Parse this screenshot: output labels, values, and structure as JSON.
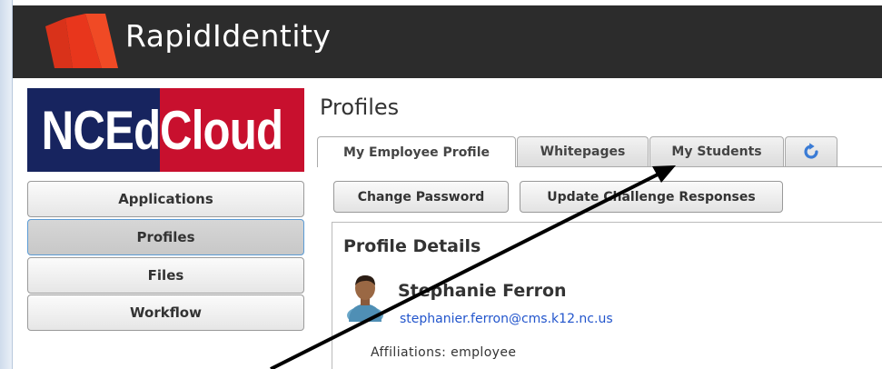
{
  "app": {
    "brand_name": "RapidIdentity",
    "brand_logo_icon": "rapididentity-logo-icon",
    "header_bg_color": "#2c2c2c",
    "logo_color": "#e8361c"
  },
  "banner": {
    "left_text": "NCEd",
    "right_text": "Cloud",
    "left_color": "#17245f",
    "right_color": "#c8102e"
  },
  "sidebar": {
    "items": [
      {
        "label": "Applications",
        "active": false
      },
      {
        "label": "Profiles",
        "active": true
      },
      {
        "label": "Files",
        "active": false
      },
      {
        "label": "Workflow",
        "active": false
      }
    ]
  },
  "main": {
    "title": "Profiles",
    "tabs": [
      {
        "label": "My Employee Profile",
        "active": true
      },
      {
        "label": "Whitepages",
        "active": false
      },
      {
        "label": "My Students",
        "active": false
      }
    ],
    "refresh_icon": "refresh-icon",
    "actions": {
      "change_password": "Change Password",
      "update_challenge": "Update Challenge Responses"
    },
    "details": {
      "title": "Profile Details",
      "avatar_icon": "user-avatar-icon",
      "name": "Stephanie Ferron",
      "email": "stephanier.ferron@cms.k12.nc.us",
      "affiliations_label": "Affiliations:",
      "affiliations_value": "employee"
    }
  },
  "annotation": {
    "arrow_icon": "pointer-arrow-icon",
    "arrow_color": "#000000"
  }
}
